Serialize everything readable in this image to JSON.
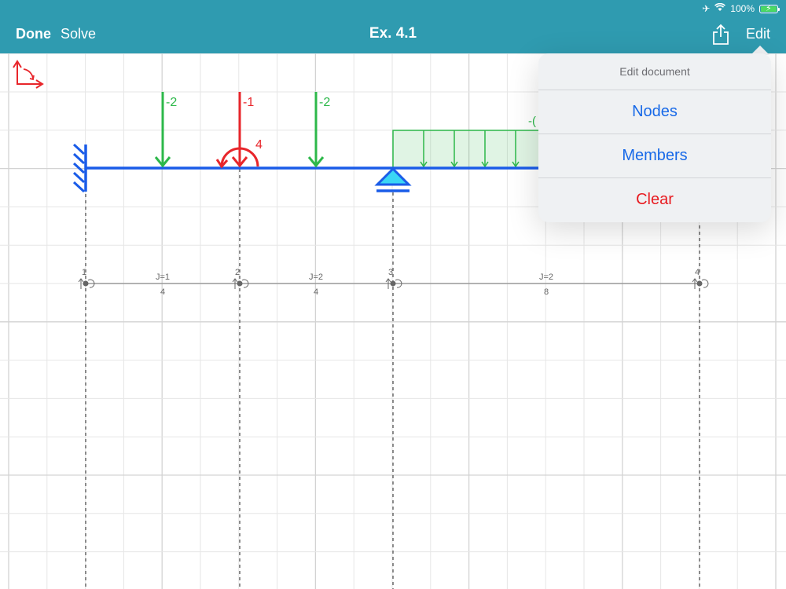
{
  "status_bar": {
    "airplane_icon": "airplane-icon",
    "wifi_icon": "wifi-icon",
    "battery_text": "100%",
    "battery_level": 1.0
  },
  "nav": {
    "done_label": "Done",
    "solve_label": "Solve",
    "title": "Ex. 4.1",
    "share_icon": "share-icon",
    "edit_label": "Edit"
  },
  "colors": {
    "nav_background": "#2f9bb0",
    "beam": "#1a5ce8",
    "load_green": "#2db84a",
    "load_red": "#e8262b",
    "support_cyan": "#3ad6f5",
    "destructive": "#e81b20",
    "action_blue": "#1769e8"
  },
  "model": {
    "axes_icon": "axes-icon",
    "loads": {
      "point_load_1": "-2",
      "point_load_2": "-1",
      "moment_2": "4",
      "point_load_3": "-2",
      "distributed_load_partial": "-("
    },
    "nodes": [
      {
        "id": "1"
      },
      {
        "id": "2"
      },
      {
        "id": "3"
      },
      {
        "id": "4"
      }
    ],
    "members": [
      {
        "stiffness": "J=1",
        "length": "4"
      },
      {
        "stiffness": "J=2",
        "length": "4"
      },
      {
        "stiffness": "J=2",
        "length": "8"
      }
    ]
  },
  "popover": {
    "header": "Edit document",
    "items": [
      {
        "label": "Nodes"
      },
      {
        "label": "Members"
      },
      {
        "label": "Clear"
      }
    ]
  }
}
